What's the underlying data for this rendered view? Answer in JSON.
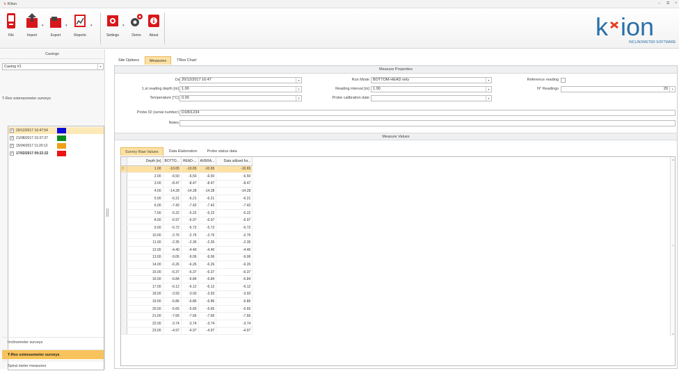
{
  "window": {
    "title": "Kliion"
  },
  "ribbon": {
    "file": "File",
    "import": "Import",
    "export": "Export",
    "reports": "Reports",
    "settings": "Settings",
    "demo": "Demo",
    "about": "About",
    "dropdown_glyph": "▾"
  },
  "logo": {
    "text": "kxion",
    "tagline": "INCLINOMETER SOFTWARE"
  },
  "sidebar": {
    "header": "Casings",
    "casing_value": "Casing #1",
    "section_label": "T-Rex extensometer surveys",
    "surveys": [
      {
        "date": "20/12/2017 16:47:54",
        "color": "#0b0bd8",
        "checked": "✓",
        "bold": false
      },
      {
        "date": "21/08/2017 15:37:37",
        "color": "#0a8a1e",
        "checked": "✓",
        "bold": false
      },
      {
        "date": "15/04/2017 11:20:12",
        "color": "#f0a018",
        "checked": "✓",
        "bold": false
      },
      {
        "date": "17/02/2017 09:22:22",
        "color": "#ee1111",
        "checked": "✓",
        "bold": true
      }
    ],
    "nav": {
      "inclinometer": "Inclinometer surveys",
      "trex": "T-Rex extensometer surveys",
      "spiral": "Spiral meter measures"
    }
  },
  "tabs": {
    "site_options": "Site Options",
    "measures": "Measures",
    "trex_chart": "TRex Chart"
  },
  "measure_properties": {
    "header": "Measure Properties",
    "datetime_label": "Date/Time",
    "datetime_value": "20/12/2017 16:47",
    "first_depth_label": "1.st reading depth [m]",
    "first_depth_value": "1.00",
    "temperature_label": "Temperature [°C]",
    "temperature_value": "0.00",
    "run_mode_label": "Run Mode",
    "run_mode_value": "BOTTOM-HEAD only",
    "reading_interval_label": "Reading interval [m]",
    "reading_interval_value": "1.00",
    "probe_cal_label": "Probe calibration date",
    "probe_cal_value": "",
    "reference_label": "Reference reading",
    "n_readings_label": "N° Readings",
    "n_readings_value": "29",
    "probe_id_label": "Probe ID (serial number)",
    "probe_id_value": "D1801234",
    "notes_label": "Notes",
    "notes_value": ""
  },
  "measure_values": {
    "header": "Measure Values",
    "subtabs": {
      "raw": "Survey Raw Values",
      "elab": "Data Elaboration",
      "probe": "Probe status data"
    },
    "columns": [
      "Depth [m]",
      "BOTTO...",
      "HEAD-...",
      "AVERA...",
      "Data utilized for..."
    ],
    "selected_marker": "D",
    "rows": [
      [
        "1.00",
        "-10.65",
        "-10.65",
        "-10.65",
        "-10.65"
      ],
      [
        "2.00",
        "-6.50",
        "-6.50",
        "-6.50",
        "-6.50"
      ],
      [
        "3.00",
        "-8.47",
        "-8.47",
        "-8.47",
        "-8.47"
      ],
      [
        "4.00",
        "-14.28",
        "-14.28",
        "-14.28",
        "-14.28"
      ],
      [
        "5.00",
        "-6.21",
        "-6.21",
        "-6.21",
        "-6.21"
      ],
      [
        "6.00",
        "-7.42",
        "-7.42",
        "-7.42",
        "-7.42"
      ],
      [
        "7.00",
        "-5.22",
        "-5.22",
        "-5.22",
        "-5.22"
      ],
      [
        "8.00",
        "-6.97",
        "-6.97",
        "-6.97",
        "-6.97"
      ],
      [
        "9.00",
        "-5.72",
        "-5.72",
        "-5.72",
        "-5.72"
      ],
      [
        "10.00",
        "-2.76",
        "-2.76",
        "-2.76",
        "-2.76"
      ],
      [
        "11.00",
        "-2.35",
        "-2.35",
        "-2.35",
        "-2.35"
      ],
      [
        "12.00",
        "-4.40",
        "-4.40",
        "-4.40",
        "-4.40"
      ],
      [
        "13.00",
        "-9.06",
        "-9.06",
        "-9.06",
        "-9.06"
      ],
      [
        "14.00",
        "-6.26",
        "-6.26",
        "-6.26",
        "-6.26"
      ],
      [
        "15.00",
        "-6.37",
        "-6.37",
        "-6.37",
        "-6.37"
      ],
      [
        "16.00",
        "-6.84",
        "-6.84",
        "-6.84",
        "-6.84"
      ],
      [
        "17.00",
        "-6.12",
        "-6.12",
        "-6.12",
        "-6.12"
      ],
      [
        "18.00",
        "-3.93",
        "-3.93",
        "-3.93",
        "-3.93"
      ],
      [
        "19.00",
        "-6.86",
        "-6.86",
        "-6.86",
        "-6.86"
      ],
      [
        "20.00",
        "-5.65",
        "-5.65",
        "-5.65",
        "-5.65"
      ],
      [
        "21.00",
        "-7.66",
        "-7.66",
        "-7.66",
        "-7.66"
      ],
      [
        "22.00",
        "-3.74",
        "-3.74",
        "-3.74",
        "-3.74"
      ],
      [
        "23.00",
        "-4.97",
        "-4.97",
        "-4.97",
        "-4.97"
      ]
    ]
  },
  "glyphs": {
    "spin": "⇕",
    "down": "▾",
    "up": "▴",
    "dn": "▾",
    "grip": "≡",
    "minimize": "–",
    "restore": "⧉",
    "close": "×"
  }
}
